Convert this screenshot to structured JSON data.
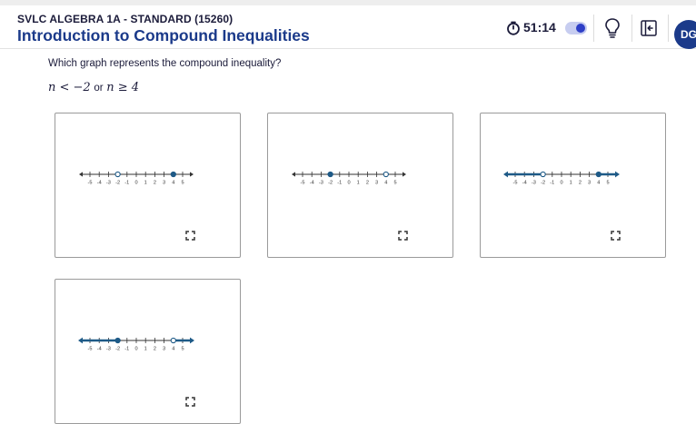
{
  "header": {
    "course": "SVLC ALGEBRA 1A - STANDARD (15260)",
    "lesson": "Introduction to Compound Inequalities",
    "timer": "51:14",
    "avatar_initials": "DG"
  },
  "question": {
    "prompt": "Which graph represents the compound inequality?",
    "inequality_left": "n < −2",
    "joiner": "or",
    "inequality_right": "n ≥ 4"
  },
  "tick_labels": [
    "-5",
    "-4",
    "-3",
    "-2",
    "-1",
    "0",
    "1",
    "2",
    "3",
    "4",
    "5"
  ],
  "options": [
    {
      "name": "graph-option-1",
      "range": [
        -5,
        5
      ],
      "points": [
        {
          "value": -2,
          "filled": false
        },
        {
          "value": 4,
          "filled": true
        }
      ],
      "shaded": []
    },
    {
      "name": "graph-option-2",
      "range": [
        -5,
        5
      ],
      "points": [
        {
          "value": -2,
          "filled": true
        },
        {
          "value": 4,
          "filled": false
        }
      ],
      "shaded": []
    },
    {
      "name": "graph-option-3",
      "range": [
        -5,
        5
      ],
      "points": [
        {
          "value": -2,
          "filled": false
        },
        {
          "value": 4,
          "filled": true
        }
      ],
      "shaded": [
        [
          "-inf",
          -2
        ],
        [
          4,
          "inf"
        ]
      ]
    },
    {
      "name": "graph-option-4",
      "range": [
        -5,
        5
      ],
      "points": [
        {
          "value": -2,
          "filled": true
        },
        {
          "value": 4,
          "filled": false
        }
      ],
      "shaded": [
        [
          "-inf",
          -2
        ],
        [
          4,
          "inf"
        ]
      ]
    }
  ],
  "colors": {
    "accent": "#1b3a8a",
    "line": "#1e5a87",
    "toggle": "#2e3fc7"
  }
}
